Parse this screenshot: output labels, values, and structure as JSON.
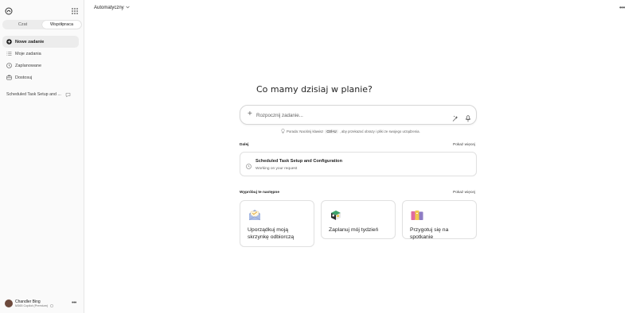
{
  "sidebar": {
    "toggle": {
      "chat_label": "Czat",
      "collab_label": "Współpraca",
      "active": "Współpraca"
    },
    "nav": [
      {
        "label": "Nowe zadanie",
        "icon": "new-task-icon",
        "active": true
      },
      {
        "label": "Moje zadania",
        "icon": "list-icon",
        "active": false
      },
      {
        "label": "Zaplanowane",
        "icon": "clock-icon",
        "active": false
      },
      {
        "label": "Dostosuj",
        "icon": "customize-icon",
        "active": false
      }
    ],
    "recent_task": {
      "label": "Scheduled Task Setup and ..."
    },
    "user": {
      "name": "Chandler Bing",
      "plan": "M365 Copilot (Premium)"
    }
  },
  "topbar": {
    "model_label": "Automatyczny"
  },
  "main": {
    "greeting": "Co mamy dzisiaj w planie?",
    "input_placeholder": "Rozpocznij zadanie...",
    "tip": {
      "before": "Porada: Naciśnij klawisz",
      "key": "Ctrl+U",
      "after": ", aby przekazać obrazy i pliki ze swojego urządzenia."
    },
    "next_section": {
      "label": "Dalej",
      "show_more": "Pokaż więcej",
      "task_title": "Scheduled Task Setup and Configuration",
      "task_status": "Working on your request"
    },
    "try_section": {
      "label": "Wypróbuj te następne",
      "show_more": "Pokaż więcej",
      "cards": [
        {
          "label": "Uporządkuj moją skrzynkę odbiorczą",
          "icon": "inbox-envelope-icon"
        },
        {
          "label": "Zaplanuj mój tydzień",
          "icon": "calendar-blocks-icon"
        },
        {
          "label": "Przygotuj się na spotkanie",
          "icon": "meeting-folders-icon"
        }
      ]
    }
  },
  "colors": {
    "sidebar_bg": "#fafafa",
    "active_item_bg": "#ececec",
    "text": "#242424",
    "muted": "#616161"
  }
}
